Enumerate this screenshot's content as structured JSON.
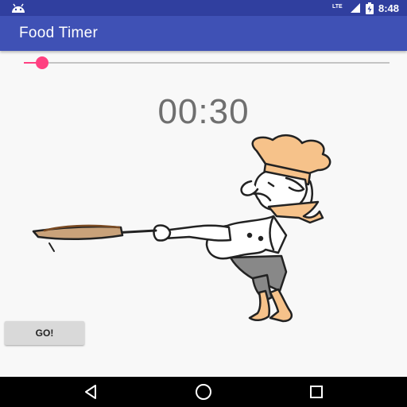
{
  "status_bar": {
    "time": "8:48",
    "network": "LTE",
    "icons": [
      "android-icon",
      "lte-icon",
      "signal-icon",
      "battery-icon"
    ]
  },
  "app_bar": {
    "title": "Food Timer"
  },
  "seekbar": {
    "progress": 0.05,
    "accent_color": "#ff4081"
  },
  "timer": {
    "display": "00:30"
  },
  "go_button": {
    "label": "GO!"
  },
  "nav_bar": {
    "buttons": [
      "back-icon",
      "home-icon",
      "recents-icon"
    ]
  },
  "colors": {
    "status_bar": "#303f9f",
    "app_bar": "#3f51b5",
    "accent": "#ff4081"
  }
}
